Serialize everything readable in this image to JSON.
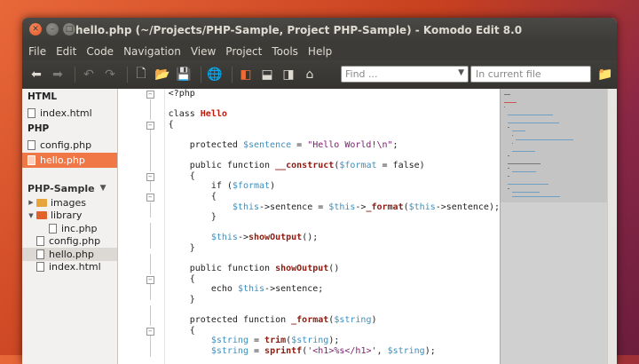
{
  "window": {
    "title": "hello.php (~/Projects/PHP-Sample, Project PHP-Sample) - Komodo Edit 8.0"
  },
  "menu": [
    "File",
    "Edit",
    "Code",
    "Navigation",
    "View",
    "Project",
    "Tools",
    "Help"
  ],
  "toolbar": {
    "icons": [
      "back-arrow-icon",
      "forward-arrow-icon",
      "undo-icon",
      "redo-icon",
      "new-file-icon",
      "open-folder-icon",
      "save-icon",
      "globe-icon",
      "left-pane-icon",
      "bottom-pane-icon",
      "right-pane-icon",
      "toolbox-icon"
    ],
    "find_placeholder": "Find ...",
    "scope_placeholder": "In current file"
  },
  "sidebar": {
    "groups": [
      {
        "label": "HTML",
        "files": [
          "index.html"
        ]
      },
      {
        "label": "PHP",
        "files": [
          "config.php",
          "hello.php"
        ]
      }
    ],
    "selected_file": "hello.php",
    "project": {
      "name": "PHP-Sample",
      "tree": [
        {
          "label": "images",
          "type": "folder",
          "open": false,
          "depth": 0
        },
        {
          "label": "library",
          "type": "folder",
          "open": true,
          "depth": 0
        },
        {
          "label": "inc.php",
          "type": "file",
          "depth": 1
        },
        {
          "label": "config.php",
          "type": "file",
          "depth": 0
        },
        {
          "label": "hello.php",
          "type": "file",
          "depth": 0,
          "selected": true
        },
        {
          "label": "index.html",
          "type": "file",
          "depth": 0
        }
      ]
    }
  },
  "editor": {
    "code_lines": [
      "<?php",
      "",
      "class Hello",
      "{",
      "",
      "    protected $sentence = \"Hello World!\\n\";",
      "",
      "    public function __construct($format = false)",
      "    {",
      "        if ($format)",
      "        {",
      "            $this->sentence = $this->_format($this->sentence);",
      "        }",
      "",
      "        $this->showOutput();",
      "    }",
      "",
      "    public function showOutput()",
      "    {",
      "        echo $this->sentence;",
      "    }",
      "",
      "    protected function _format($string)",
      "    {",
      "        $string = trim($string);",
      "        $string = sprintf('<h1>%s</h1>', $string);"
    ]
  },
  "colors": {
    "accent": "#f07746",
    "titlebar": "#3c3b37",
    "keyword_class": "#c1190b",
    "variable": "#3b8fbe",
    "string": "#7a1a6e"
  }
}
